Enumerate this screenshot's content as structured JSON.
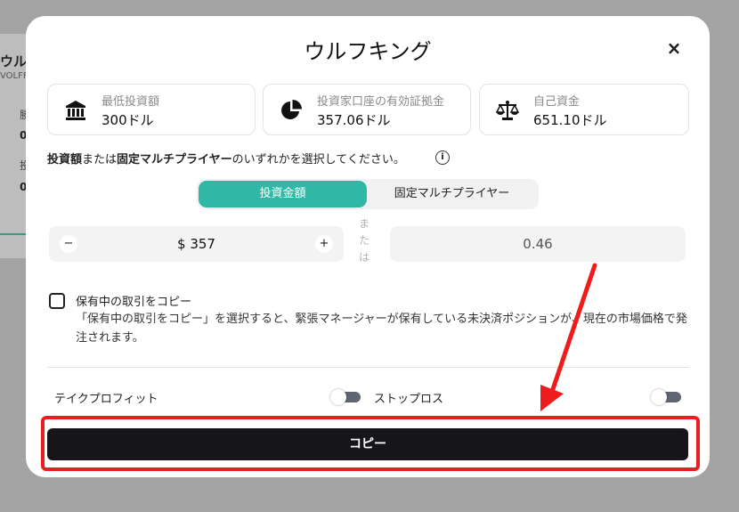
{
  "background": {
    "title": "ウルフ",
    "subtitle": "VOLFF",
    "row1_label": "勝",
    "row1_value": "0",
    "row2_label": "投",
    "row2_value": "0"
  },
  "modal": {
    "title": "ウルフキング",
    "close_glyph": "×",
    "cards": [
      {
        "label": "最低投資額",
        "value": "300ドル",
        "icon": "bank-icon"
      },
      {
        "label": "投資家口座の有効証拠金",
        "value": "357.06ドル",
        "icon": "pie-chart-icon"
      },
      {
        "label": "自己資金",
        "value": "651.10ドル",
        "icon": "scale-icon"
      }
    ],
    "instruction_bold1": "投資額",
    "instruction_normal1": "または",
    "instruction_bold2": "固定マルチプライヤー",
    "instruction_normal2": "のいずれかを選択してください。",
    "info_glyph": "i",
    "segment": {
      "active_label": "投資金額",
      "inactive_label": "固定マルチプライヤー"
    },
    "amount": {
      "minus": "−",
      "value": "$ 357",
      "plus": "+"
    },
    "or_label": [
      "ま",
      "た",
      "は"
    ],
    "multiplier_value": "0.46",
    "copy_positions": {
      "label": "保有中の取引をコピー",
      "description": "「保有中の取引をコピー」を選択すると、緊張マネージャーが保有している未決済ポジションが、現在の市場価格で発注されます。",
      "checked": false
    },
    "take_profit_label": "テイクプロフィット",
    "stop_loss_label": "ストップロス",
    "copy_button_label": "コピー"
  },
  "colors": {
    "accent": "#2fb8a5",
    "button": "#16161a",
    "highlight": "#ee1c1c"
  }
}
